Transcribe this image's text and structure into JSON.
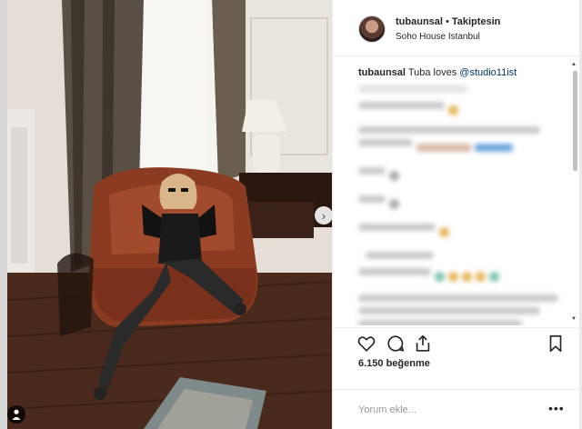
{
  "post": {
    "username": "tubaunsal",
    "separator": "•",
    "follow_status": "Takiptesin",
    "location": "Soho House Istanbul",
    "caption_user": "tubaunsal",
    "caption_text": "Tuba loves",
    "caption_mention": "@studio11ist",
    "likes": "6.150 beğenme",
    "comment_placeholder": "Yorum ekle...",
    "more_label": "•••"
  },
  "icons": {
    "like": "heart-icon",
    "comment": "comment-bubble-icon",
    "share": "share-icon",
    "save": "bookmark-icon",
    "next": "chevron-right-icon",
    "tagged": "person-tag-icon"
  },
  "colors": {
    "mention": "#003569",
    "panel_bg": "#ffffff",
    "page_bg": "#fafafa"
  }
}
